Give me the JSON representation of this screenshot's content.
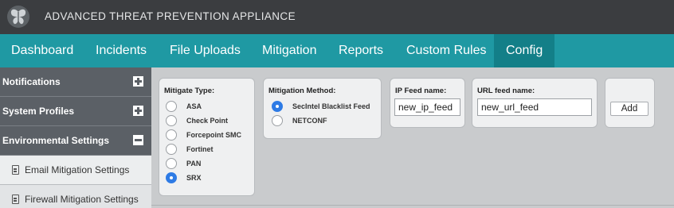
{
  "app": {
    "title": "ADVANCED THREAT PREVENTION APPLIANCE",
    "logo_icon": "butterfly-logo-icon"
  },
  "nav": {
    "tabs": [
      {
        "label": "Dashboard"
      },
      {
        "label": "Incidents"
      },
      {
        "label": "File Uploads"
      },
      {
        "label": "Mitigation"
      },
      {
        "label": "Reports"
      },
      {
        "label": "Custom Rules"
      },
      {
        "label": "Config",
        "active": true
      }
    ]
  },
  "sidebar": {
    "sections": [
      {
        "label": "Notifications",
        "toggle_icon": "plus-icon"
      },
      {
        "label": "System Profiles",
        "toggle_icon": "plus-icon"
      },
      {
        "label": "Environmental Settings",
        "toggle_icon": "minus-icon"
      }
    ],
    "subitems": [
      {
        "label": "Email Mitigation Settings",
        "icon": "document-icon"
      },
      {
        "label": "Firewall Mitigation Settings",
        "icon": "document-icon"
      }
    ]
  },
  "mitigate_type": {
    "title": "Mitigate Type:",
    "options": [
      {
        "label": "ASA",
        "checked": false
      },
      {
        "label": "Check Point",
        "checked": false
      },
      {
        "label": "Forcepoint SMC",
        "checked": false
      },
      {
        "label": "Fortinet",
        "checked": false
      },
      {
        "label": "PAN",
        "checked": false
      },
      {
        "label": "SRX",
        "checked": true
      }
    ]
  },
  "mitigation_method": {
    "title": "Mitigation Method:",
    "options": [
      {
        "label": "SecIntel Blacklist Feed",
        "checked": true
      },
      {
        "label": "NETCONF",
        "checked": false
      }
    ]
  },
  "ip_feed": {
    "title": "IP Feed name:",
    "value": "new_ip_feed"
  },
  "url_feed": {
    "title": "URL feed name:",
    "value": "new_url_feed"
  },
  "actions": {
    "add_label": "Add"
  },
  "colors": {
    "header": "#3b3d40",
    "nav": "#1f99a3",
    "nav_active": "#137f88",
    "sidebar": "#5b6066",
    "radio_checked": "#2e7be5"
  }
}
